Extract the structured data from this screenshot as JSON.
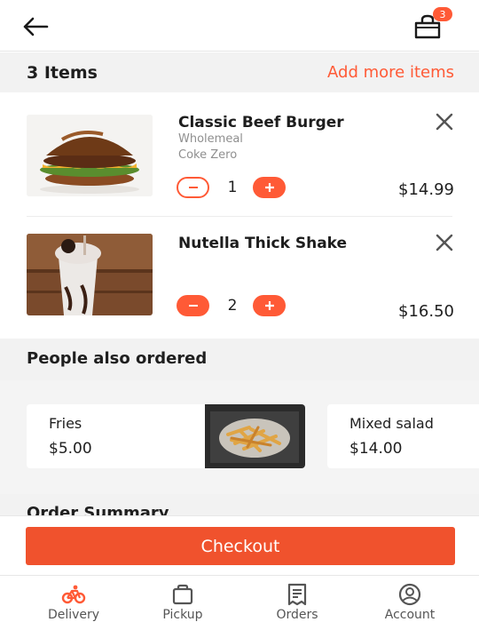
{
  "header": {
    "cart_count": "3",
    "back_icon": "arrow-left-icon",
    "cart_icon": "shopping-bag-icon"
  },
  "cart": {
    "count_label": "3 Items",
    "add_more_label": "Add more items",
    "items": [
      {
        "name": "Classic Beef Burger",
        "options": [
          "Wholemeal",
          "Coke Zero"
        ],
        "quantity": "1",
        "price": "$14.99"
      },
      {
        "name": "Nutella Thick Shake",
        "options": [],
        "quantity": "2",
        "price": "$16.50"
      }
    ]
  },
  "also_ordered": {
    "title": "People also ordered",
    "items": [
      {
        "name": "Fries",
        "price": "$5.00"
      },
      {
        "name": "Mixed salad",
        "price": "$14.00"
      }
    ]
  },
  "summary": {
    "title": "Order Summary"
  },
  "checkout_label": "Checkout",
  "nav": {
    "tabs": [
      {
        "label": "Delivery",
        "icon": "bike-icon"
      },
      {
        "label": "Pickup",
        "icon": "bag-icon"
      },
      {
        "label": "Orders",
        "icon": "receipt-icon"
      },
      {
        "label": "Account",
        "icon": "user-circle-icon"
      }
    ]
  },
  "colors": {
    "accent": "#ff5a36",
    "checkout": "#f0522d",
    "section_bg": "#f2f2f2"
  }
}
